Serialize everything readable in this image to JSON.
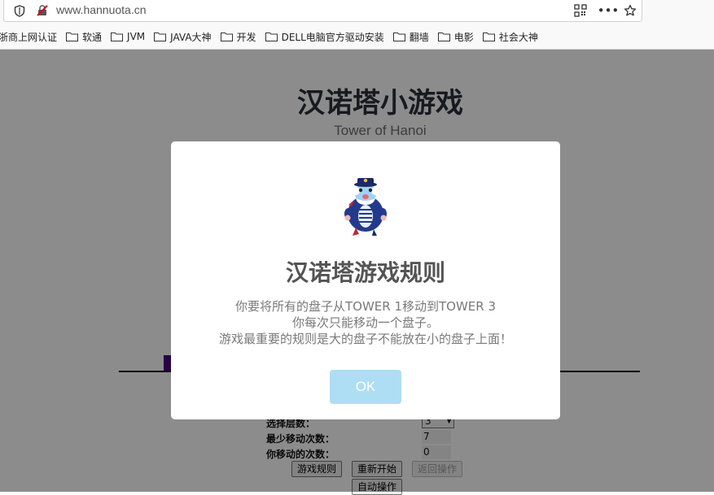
{
  "browser": {
    "url": "www.hannuota.cn",
    "bookmarks": [
      {
        "label": "浙商上网认证",
        "folder": false
      },
      {
        "label": "软通",
        "folder": true
      },
      {
        "label": "JVM",
        "folder": true
      },
      {
        "label": "JAVA大神",
        "folder": true
      },
      {
        "label": "开发",
        "folder": true
      },
      {
        "label": "DELL电脑官方驱动安装",
        "folder": true
      },
      {
        "label": "翻墙",
        "folder": true
      },
      {
        "label": "电影",
        "folder": true
      },
      {
        "label": "社会大神",
        "folder": true
      }
    ]
  },
  "game": {
    "title": "汉诺塔小游戏",
    "subtitle": "Tower of Hanoi",
    "disk_color": "#4b0082",
    "controls": {
      "layers_label": "选择层数：",
      "layers_value": "3",
      "min_moves_label": "最少移动次数：",
      "min_moves_value": "7",
      "your_moves_label": "你移动的次数：",
      "your_moves_value": "0"
    },
    "buttons": {
      "rules": "游戏规则",
      "restart": "重新开始",
      "undo": "返回操作",
      "auto": "自动操作"
    }
  },
  "modal": {
    "title": "汉诺塔游戏规则",
    "line1": "你要将所有的盘子从TOWER 1移动到TOWER 3",
    "line2": "你每次只能移动一个盘子。",
    "line3": "游戏最重要的规则是大的盘子不能放在小的盘子上面！",
    "ok_label": "OK",
    "ok_color": "#aedef4"
  }
}
